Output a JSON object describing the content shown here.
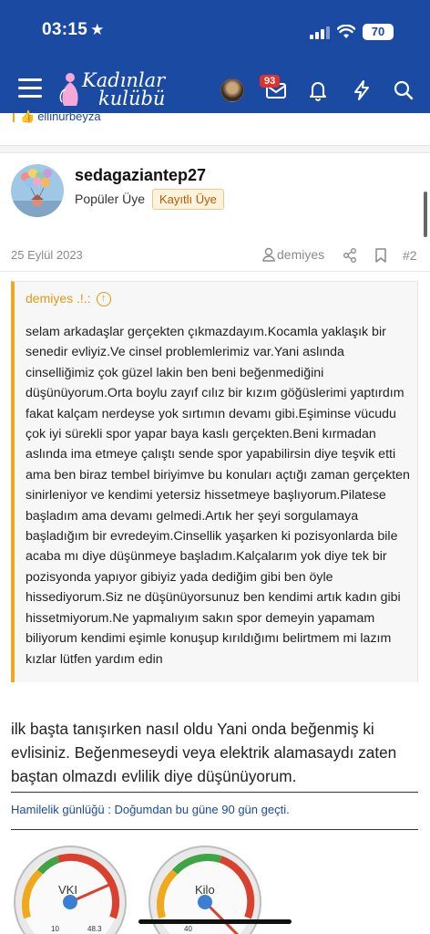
{
  "status": {
    "time": "03:15",
    "battery": "70"
  },
  "header": {
    "logo_line1": "Kadınlar",
    "logo_line2": "kulübü",
    "notification_badge": "93",
    "icons": [
      "menu-icon",
      "avatar",
      "inbox-icon",
      "bell-icon",
      "bolt-icon",
      "search-icon"
    ]
  },
  "reactions": {
    "text": "ellinurbeyza"
  },
  "post": {
    "username": "sedagaziantep27",
    "user_title": "Popüler Üye",
    "user_banner": "Kayıtlı Üye",
    "date": "25 Eylül 2023",
    "author_link": "demiyes",
    "post_number": "#2",
    "quote": {
      "author": "demiyes .!.:",
      "text": "selam arkadaşlar gerçekten çıkmazdayım.Kocamla yaklaşık bir senedir evliyiz.Ve cinsel problemlerimiz var.Yani aslında cinselliğimiz çok güzel lakin ben beni beğenmediğini düşünüyorum.Orta boylu zayıf cılız bir kızım göğüslerimi yaptırdım fakat kalçam nerdeyse yok sırtımın devamı gibi.Eşiminse vücudu çok iyi sürekli spor yapar baya kaslı gerçekten.Beni kırmadan aslında ima etmeye çalıştı sende spor yapabilirsin diye teşvik etti ama ben biraz tembel biriyimve bu konuları açtığı zaman gerçekten sinirleniyor ve kendimi yetersiz hissetmeye başlıyorum.Pilatese başladım ama devamı gelmedi.Artık her şeyi sorgulamaya başladığım bir evredeyim.Cinsellik yaşarken ki pozisyonlarda bile acaba mı diye düşünmeye başladım.Kalçalarım yok diye tek bir pozisyonda yapıyor gibiyiz yada dediğim gibi ben öyle hissediyorum.Siz ne düşünüyorsunuz ben kendimi artık kadın gibi hissetmiyorum.Ne yapmalıyım sakın spor demeyin yapamam biliyorum kendimi eşimle konuşup kırıldığımı belirtmem mi lazım kızlar lütfen yardım edin"
    },
    "body": "ilk başta tanışırken nasıl oldu Yani onda beğenmiş ki evlisiniz. Beğenmeseydi veya elektrik alamasaydı zaten baştan olmazdı evlilik diye düşünüyorum.",
    "signature": "Hamilelik günlüğü : Doğumdan bu güne 90 gün geçti."
  },
  "gauges": [
    {
      "label": "VKI",
      "scale_min": "10",
      "scale_max": "48.3"
    },
    {
      "label": "Kilo",
      "scale_min": "40",
      "scale_max": ""
    }
  ],
  "colors": {
    "header": "#1b4aa3",
    "accent": "#f0a81c",
    "link": "#1b4aa3"
  }
}
